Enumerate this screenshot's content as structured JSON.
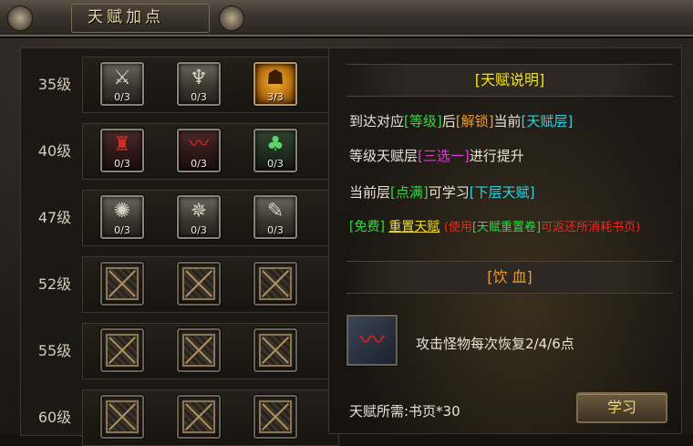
{
  "window": {
    "title": "天赋加点"
  },
  "rows": [
    {
      "level": "35级",
      "slots": [
        {
          "count": "0/3",
          "style": "silver",
          "glyph": "⚔"
        },
        {
          "count": "0/3",
          "style": "silver",
          "glyph": "♆"
        },
        {
          "count": "3/3",
          "style": "gold",
          "glyph": "☗"
        }
      ]
    },
    {
      "level": "40级",
      "slots": [
        {
          "count": "0/3",
          "style": "red",
          "glyph": "♜"
        },
        {
          "count": "0/3",
          "style": "red",
          "glyph": "〰"
        },
        {
          "count": "0/3",
          "style": "green",
          "glyph": "♣"
        }
      ]
    },
    {
      "level": "47级",
      "slots": [
        {
          "count": "0/3",
          "style": "silver",
          "glyph": "✺"
        },
        {
          "count": "0/3",
          "style": "silver",
          "glyph": "✵"
        },
        {
          "count": "0/3",
          "style": "silver",
          "glyph": "✎"
        }
      ]
    },
    {
      "level": "52级",
      "slots": [
        {
          "style": "locked"
        },
        {
          "style": "locked"
        },
        {
          "style": "locked"
        }
      ]
    },
    {
      "level": "55级",
      "slots": [
        {
          "style": "locked"
        },
        {
          "style": "locked"
        },
        {
          "style": "locked"
        }
      ]
    },
    {
      "level": "60级",
      "slots": [
        {
          "style": "locked"
        },
        {
          "style": "locked"
        },
        {
          "style": "locked"
        }
      ]
    }
  ],
  "info": {
    "header": "[天赋说明]",
    "line1": {
      "a": "到达对应",
      "b": "[等级]",
      "c": "后",
      "d": "[解锁]",
      "e": "当前",
      "f": "[天赋层]"
    },
    "line2": {
      "a": "等级天赋层",
      "b": "[三选一]",
      "c": "进行提升"
    },
    "line3": {
      "a": "当前层",
      "b": "[点满]",
      "c": "可学习",
      "d": "[下层天赋]"
    },
    "line4": {
      "a": "[免费]",
      "b": "重置天赋",
      "c": "(使用",
      "d": "[天赋重置卷]",
      "e": "可返还所消耗书页)"
    }
  },
  "skill": {
    "header": "[饮 血]",
    "icon": "blood-sip-icon",
    "description": "攻击怪物每次恢复2/4/6点",
    "cost": "天赋所需:书页*30",
    "learn_button": "学习"
  },
  "colors": {
    "green": "#37d645",
    "orange": "#ef9b2a",
    "cyan": "#27d6e6",
    "magenta": "#e03ad9",
    "yellow": "#f2e31c",
    "red": "#f0271c"
  }
}
